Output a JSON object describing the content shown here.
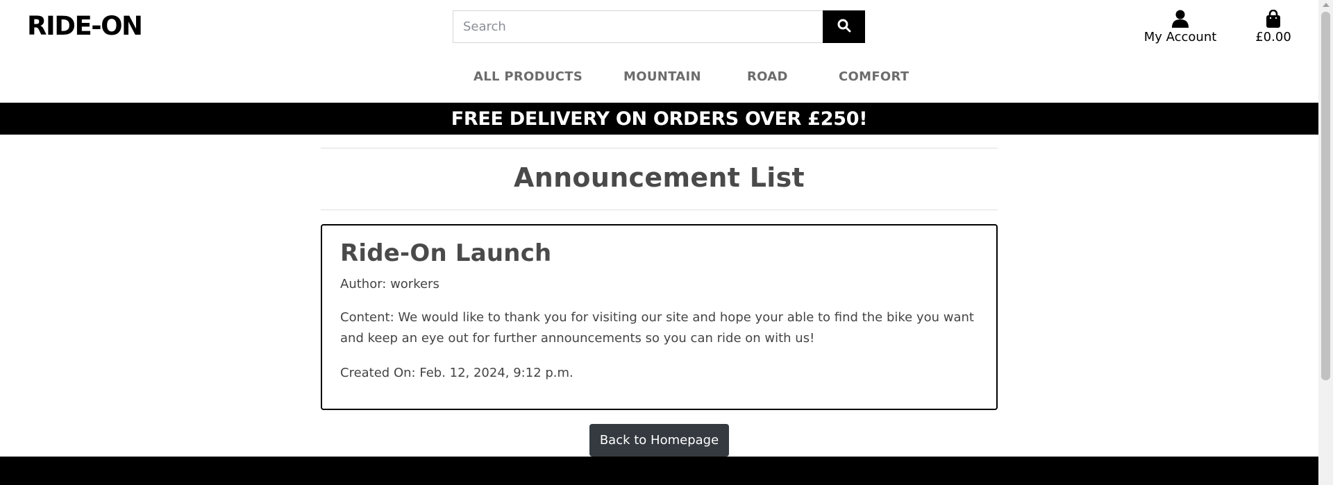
{
  "header": {
    "logo": "RIDE-ON",
    "search": {
      "placeholder": "Search",
      "value": ""
    },
    "search_icon": "search-icon",
    "account_label": "My Account",
    "account_icon": "user-icon",
    "bag_total": "£0.00",
    "bag_icon": "shopping-bag-icon"
  },
  "nav": {
    "items": [
      {
        "label": "ALL PRODUCTS"
      },
      {
        "label": "MOUNTAIN"
      },
      {
        "label": "ROAD"
      },
      {
        "label": "COMFORT"
      }
    ]
  },
  "banner": {
    "text": "FREE DELIVERY ON ORDERS OVER £250!"
  },
  "main": {
    "title": "Announcement List",
    "announcement": {
      "title": "Ride-On Launch",
      "author": "Author: workers",
      "content": "Content: We would like to thank you for visiting our site and hope your able to find the bike you want and keep an eye out for further announcements so you can ride on with us!",
      "created": "Created On: Feb. 12, 2024, 9:12 p.m."
    },
    "back_button": "Back to Homepage"
  },
  "colors": {
    "banner_bg": "#000000",
    "button_bg": "#343a40",
    "nav_text": "#6c6c6c"
  }
}
